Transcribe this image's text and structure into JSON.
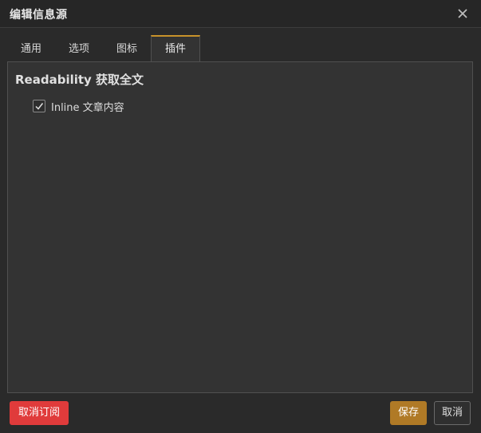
{
  "dialog": {
    "title": "编辑信息源"
  },
  "tabs": [
    {
      "label": "通用",
      "active": false
    },
    {
      "label": "选项",
      "active": false
    },
    {
      "label": "图标",
      "active": false
    },
    {
      "label": "插件",
      "active": true
    }
  ],
  "plugins": {
    "section_title": "Readability 获取全文",
    "options": [
      {
        "label": "Inline 文章内容",
        "checked": true
      }
    ]
  },
  "footer": {
    "unsubscribe_label": "取消订阅",
    "save_label": "保存",
    "cancel_label": "取消"
  },
  "colors": {
    "accent": "#c8922a",
    "danger": "#e03b3b",
    "save": "#b07a26"
  },
  "icons": {
    "close": "close-icon",
    "check": "checkmark-icon"
  }
}
